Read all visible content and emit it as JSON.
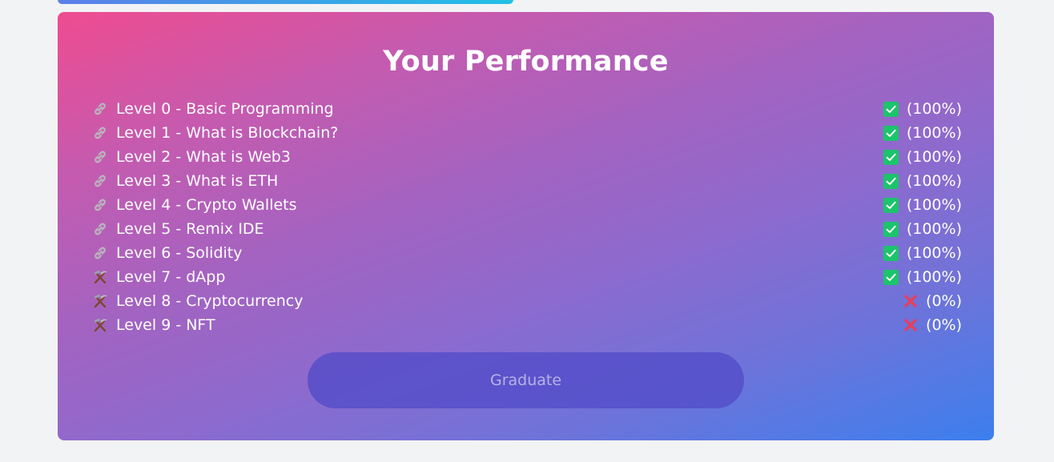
{
  "page": {
    "title": "Your Performance",
    "button_label": "Graduate"
  },
  "levels": [
    {
      "label": "Level 0 - Basic Programming",
      "icon": "link-icon",
      "status": "check-icon",
      "score": "(100%)"
    },
    {
      "label": "Level 1 - What is Blockchain?",
      "icon": "link-icon",
      "status": "check-icon",
      "score": "(100%)"
    },
    {
      "label": "Level 2 - What is Web3",
      "icon": "link-icon",
      "status": "check-icon",
      "score": "(100%)"
    },
    {
      "label": "Level 3 - What is ETH",
      "icon": "link-icon",
      "status": "check-icon",
      "score": "(100%)"
    },
    {
      "label": "Level 4 - Crypto Wallets",
      "icon": "link-icon",
      "status": "check-icon",
      "score": "(100%)"
    },
    {
      "label": "Level 5 - Remix IDE",
      "icon": "link-icon",
      "status": "check-icon",
      "score": "(100%)"
    },
    {
      "label": "Level 6 - Solidity",
      "icon": "link-icon",
      "status": "check-icon",
      "score": "(100%)"
    },
    {
      "label": "Level 7 - dApp",
      "icon": "hammer-pick-icon",
      "status": "check-icon",
      "score": "(100%)"
    },
    {
      "label": "Level 8 - Cryptocurrency",
      "icon": "hammer-pick-icon",
      "status": "cross-icon",
      "score": "(0%)"
    },
    {
      "label": "Level 9 - NFT",
      "icon": "hammer-pick-icon",
      "status": "cross-icon",
      "score": "(0%)"
    }
  ],
  "colors": {
    "gradient_start": "#ef4c90",
    "gradient_end": "#3c7fee",
    "check": "#1cc46b",
    "cross": "#e5405e"
  }
}
